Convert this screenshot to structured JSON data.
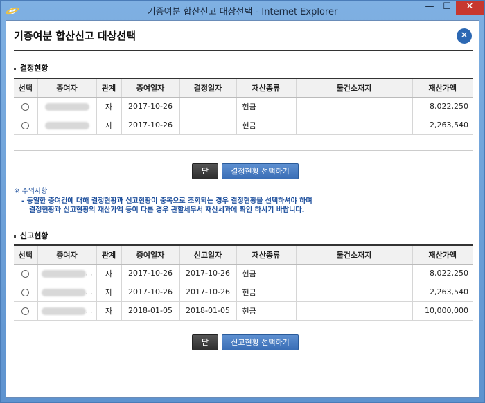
{
  "window": {
    "title": "기증여분 합산신고 대상선택 - Internet Explorer",
    "minimize": "—",
    "maximize": "☐",
    "close": "✕"
  },
  "dialog": {
    "title": "기증여분 합산신고 대상선택",
    "close_glyph": "✕"
  },
  "decision": {
    "heading": "결정현황",
    "columns": [
      "선택",
      "증여자",
      "관계",
      "증여일자",
      "결정일자",
      "재산종류",
      "물건소재지",
      "재산가액"
    ],
    "rows": [
      {
        "donor_mark": "",
        "relation": "자",
        "gift_date": "2017-10-26",
        "decision_date": "",
        "asset_type": "현금",
        "location": "",
        "value": "8,022,250"
      },
      {
        "donor_mark": "",
        "relation": "자",
        "gift_date": "2017-10-26",
        "decision_date": "",
        "asset_type": "현금",
        "location": "",
        "value": "2,263,540"
      }
    ],
    "close_label": "닫기",
    "select_label": "결정현황 선택하기"
  },
  "notice": {
    "title": "※ 주의사항",
    "line1": "- 동일한 증여건에 대해 결정현황과 신고현황이 중복으로 조회되는 경우 결정현황을 선택하셔야 하며",
    "line2": "결정현황과 신고현황의 재산가액 등이 다른 경우 관할세무서 재산세과에 확인 하시기 바랍니다."
  },
  "report": {
    "heading": "신고현황",
    "columns": [
      "선택",
      "증여자",
      "관계",
      "증여일자",
      "신고일자",
      "재산종류",
      "물건소재지",
      "재산가액"
    ],
    "rows": [
      {
        "donor_mark": "…",
        "relation": "자",
        "gift_date": "2017-10-26",
        "report_date": "2017-10-26",
        "asset_type": "현금",
        "location": "",
        "value": "8,022,250"
      },
      {
        "donor_mark": "…",
        "relation": "자",
        "gift_date": "2017-10-26",
        "report_date": "2017-10-26",
        "asset_type": "현금",
        "location": "",
        "value": "2,263,540"
      },
      {
        "donor_mark": "…",
        "relation": "자",
        "gift_date": "2018-01-05",
        "report_date": "2018-01-05",
        "asset_type": "현금",
        "location": "",
        "value": "10,000,000"
      }
    ],
    "close_label": "닫기",
    "select_label": "신고현황 선택하기"
  },
  "colors": {
    "accent_blue": "#2c68b3",
    "notice_text": "#1c4e9c",
    "titlebar": "#6d9fd4",
    "close_red": "#c7372f"
  },
  "icons": {
    "app": "internet-explorer-icon",
    "dialog_close": "close-circle-icon"
  }
}
